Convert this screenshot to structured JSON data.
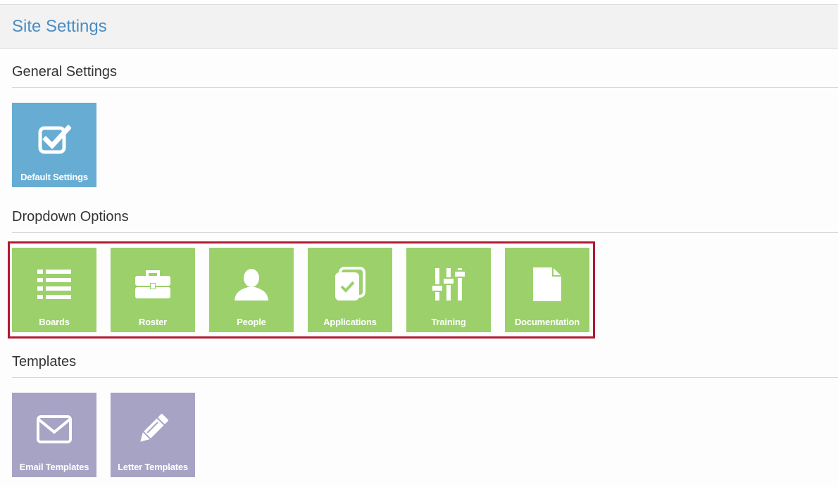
{
  "header": {
    "title": "Site Settings"
  },
  "sections": {
    "general": {
      "title": "General Settings",
      "tiles": [
        {
          "label": "Default Settings",
          "icon": "checkbox-icon"
        }
      ]
    },
    "dropdown": {
      "title": "Dropdown Options",
      "tiles": [
        {
          "label": "Boards",
          "icon": "list-icon"
        },
        {
          "label": "Roster",
          "icon": "briefcase-icon"
        },
        {
          "label": "People",
          "icon": "person-icon"
        },
        {
          "label": "Applications",
          "icon": "application-icon"
        },
        {
          "label": "Training",
          "icon": "sliders-icon"
        },
        {
          "label": "Documentation",
          "icon": "document-icon"
        }
      ]
    },
    "templates": {
      "title": "Templates",
      "tiles": [
        {
          "label": "Email Templates",
          "icon": "envelope-icon"
        },
        {
          "label": "Letter Templates",
          "icon": "pencil-icon"
        }
      ]
    }
  },
  "colors": {
    "header_title": "#4a8cc2",
    "general_tile": "#67add3",
    "dropdown_tile": "#9bd06b",
    "template_tile": "#a7a3c5",
    "highlight": "#b11a31"
  }
}
